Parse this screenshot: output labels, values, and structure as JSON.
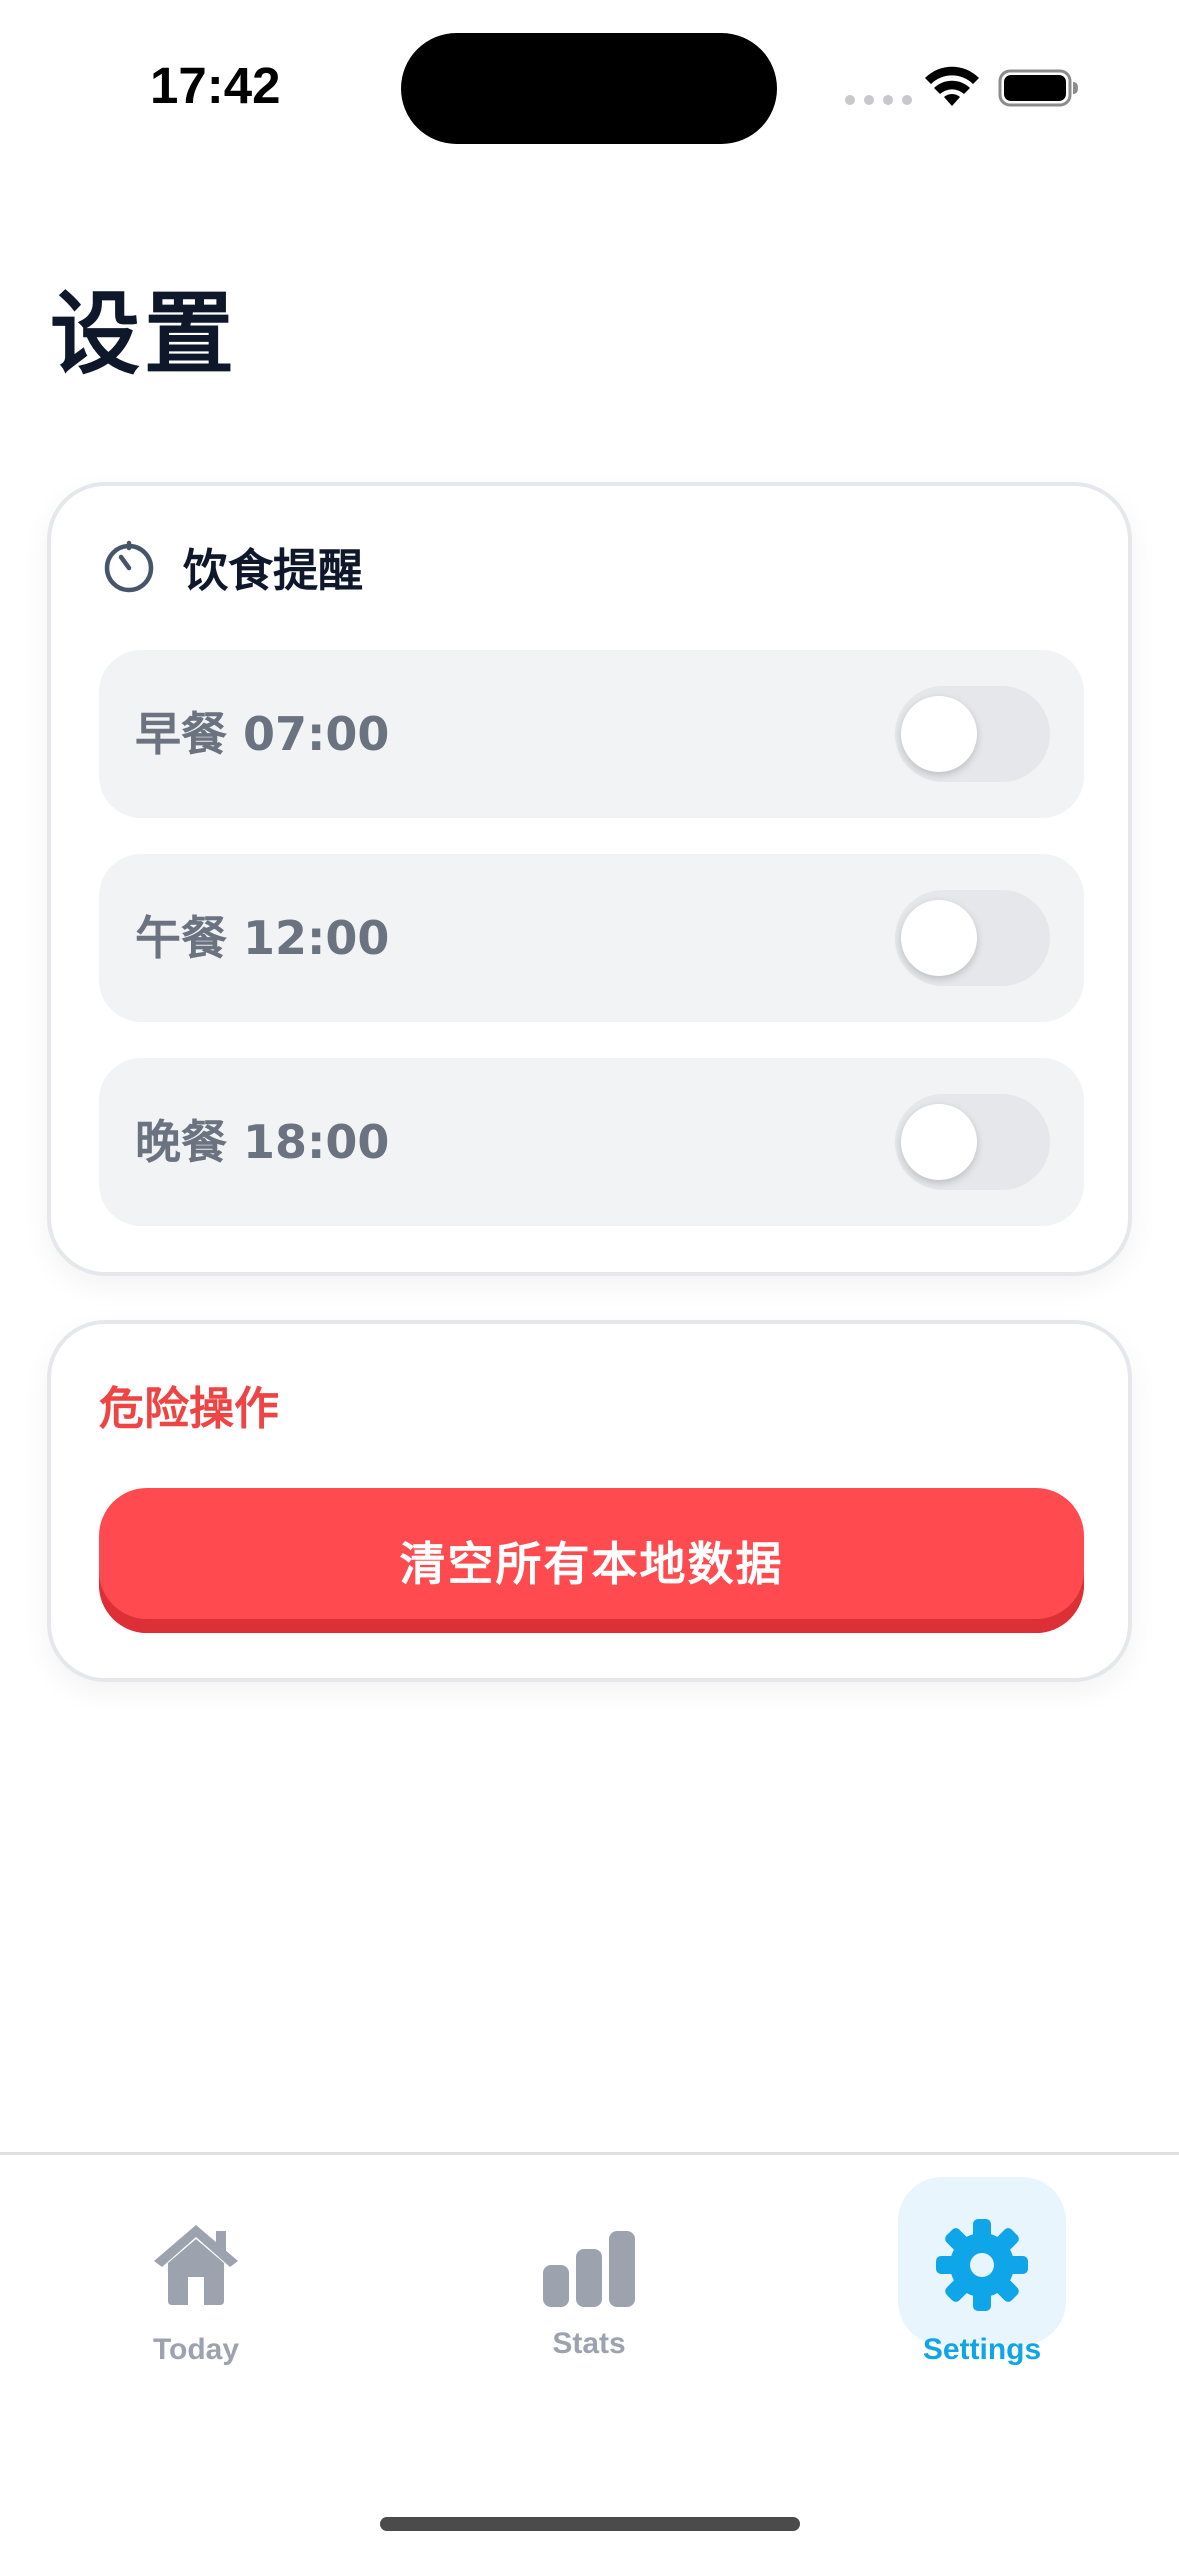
{
  "status_bar": {
    "time": "17:42"
  },
  "page": {
    "title": "设置"
  },
  "reminders": {
    "title": "饮食提醒",
    "items": [
      {
        "label": "早餐 07:00",
        "enabled": false
      },
      {
        "label": "午餐 12:00",
        "enabled": false
      },
      {
        "label": "晚餐 18:00",
        "enabled": false
      }
    ]
  },
  "danger": {
    "title": "危险操作",
    "clear_button_label": "清空所有本地数据"
  },
  "tabbar": {
    "tabs": [
      {
        "label": "Today",
        "icon": "home-icon",
        "active": false
      },
      {
        "label": "Stats",
        "icon": "bar-chart-icon",
        "active": false
      },
      {
        "label": "Settings",
        "icon": "gear-icon",
        "active": true
      }
    ]
  },
  "colors": {
    "accent": "#0ea5e9",
    "danger": "#ff4b4f",
    "danger_text": "#ef4444",
    "inactive": "#9ca3af",
    "row_bg": "#f2f3f5"
  }
}
